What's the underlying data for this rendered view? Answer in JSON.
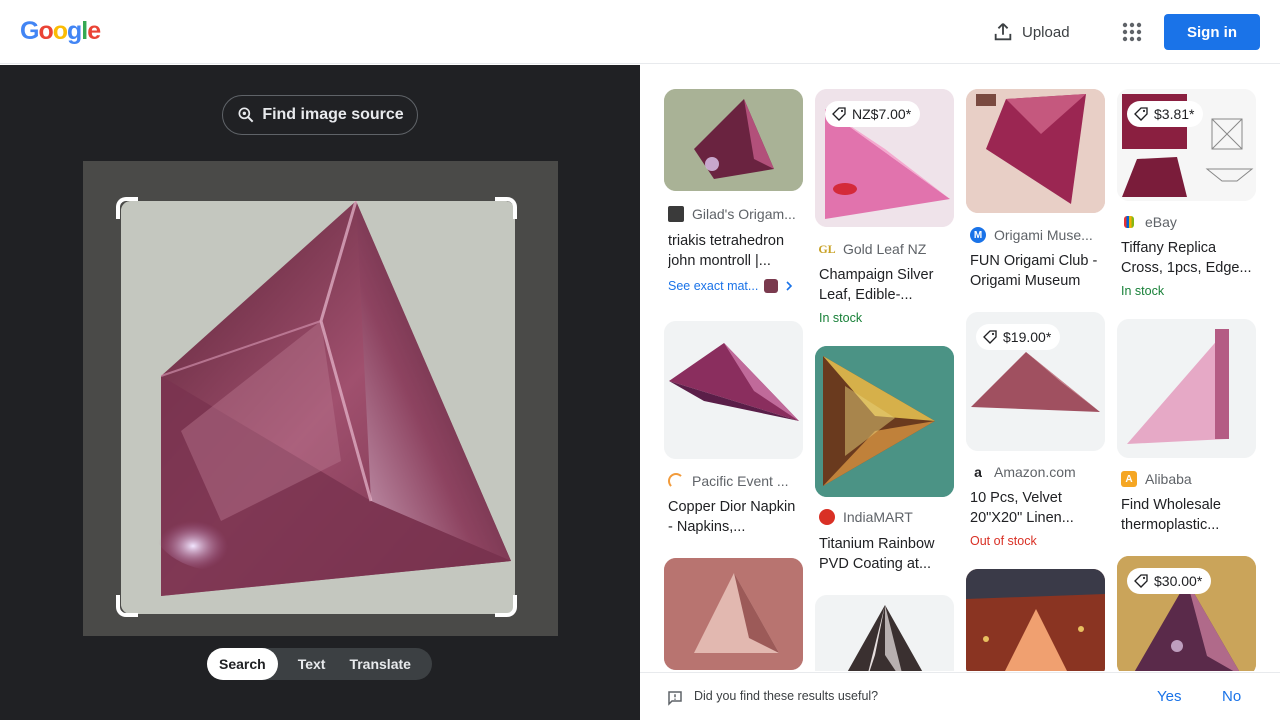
{
  "header": {
    "logo_letters": [
      "G",
      "o",
      "o",
      "g",
      "l",
      "e"
    ],
    "logo_colors": [
      "#4285F4",
      "#EA4335",
      "#FBBC05",
      "#4285F4",
      "#34A853",
      "#EA4335"
    ],
    "upload_label": "Upload",
    "apps_icon": "apps-grid-icon",
    "signin_label": "Sign in"
  },
  "lens": {
    "find_source_label": "Find image source",
    "tabs": [
      {
        "label": "Search",
        "active": true
      },
      {
        "label": "Text",
        "active": false
      },
      {
        "label": "Translate",
        "active": false
      }
    ]
  },
  "results": [
    {
      "source": "Gilad's Origam...",
      "title": "triakis tetrahedron john montroll |...",
      "price": "",
      "stock": "",
      "exact": "See exact mat..."
    },
    {
      "source": "Gold Leaf NZ",
      "title": "Champaign Silver Leaf, Edible-...",
      "price": "NZ$7.00*",
      "stock": "In stock"
    },
    {
      "source": "Origami Muse...",
      "title": "FUN Origami Club - Origami Museum",
      "price": "",
      "stock": ""
    },
    {
      "source": "eBay",
      "title": "Tiffany Replica Cross, 1pcs, Edge...",
      "price": "$3.81*",
      "stock": "In stock"
    },
    {
      "source": "Pacific Event ...",
      "title": "Copper Dior Napkin - Napkins,...",
      "price": "",
      "stock": ""
    },
    {
      "source": "IndiaMART",
      "title": "Titanium Rainbow PVD Coating at...",
      "price": "",
      "stock": ""
    },
    {
      "source": "Amazon.com",
      "title": "10 Pcs, Velvet 20\"X20\" Linen...",
      "price": "$19.00*",
      "stock": "Out of stock"
    },
    {
      "source": "Alibaba",
      "title": "Find Wholesale thermoplastic...",
      "price": "",
      "stock": ""
    },
    {
      "source": "",
      "title": "",
      "price": "",
      "stock": ""
    },
    {
      "source": "",
      "title": "",
      "price": "",
      "stock": ""
    },
    {
      "source": "",
      "title": "",
      "price": "",
      "stock": ""
    },
    {
      "source": "",
      "title": "",
      "price": "$30.00*",
      "stock": ""
    }
  ],
  "feedback": {
    "question": "Did you find these results useful?",
    "yes": "Yes",
    "no": "No"
  },
  "colors": {
    "accent": "#1a73e8",
    "in_stock": "#188038",
    "out_of_stock": "#d93025",
    "dark_panel": "#202124"
  }
}
